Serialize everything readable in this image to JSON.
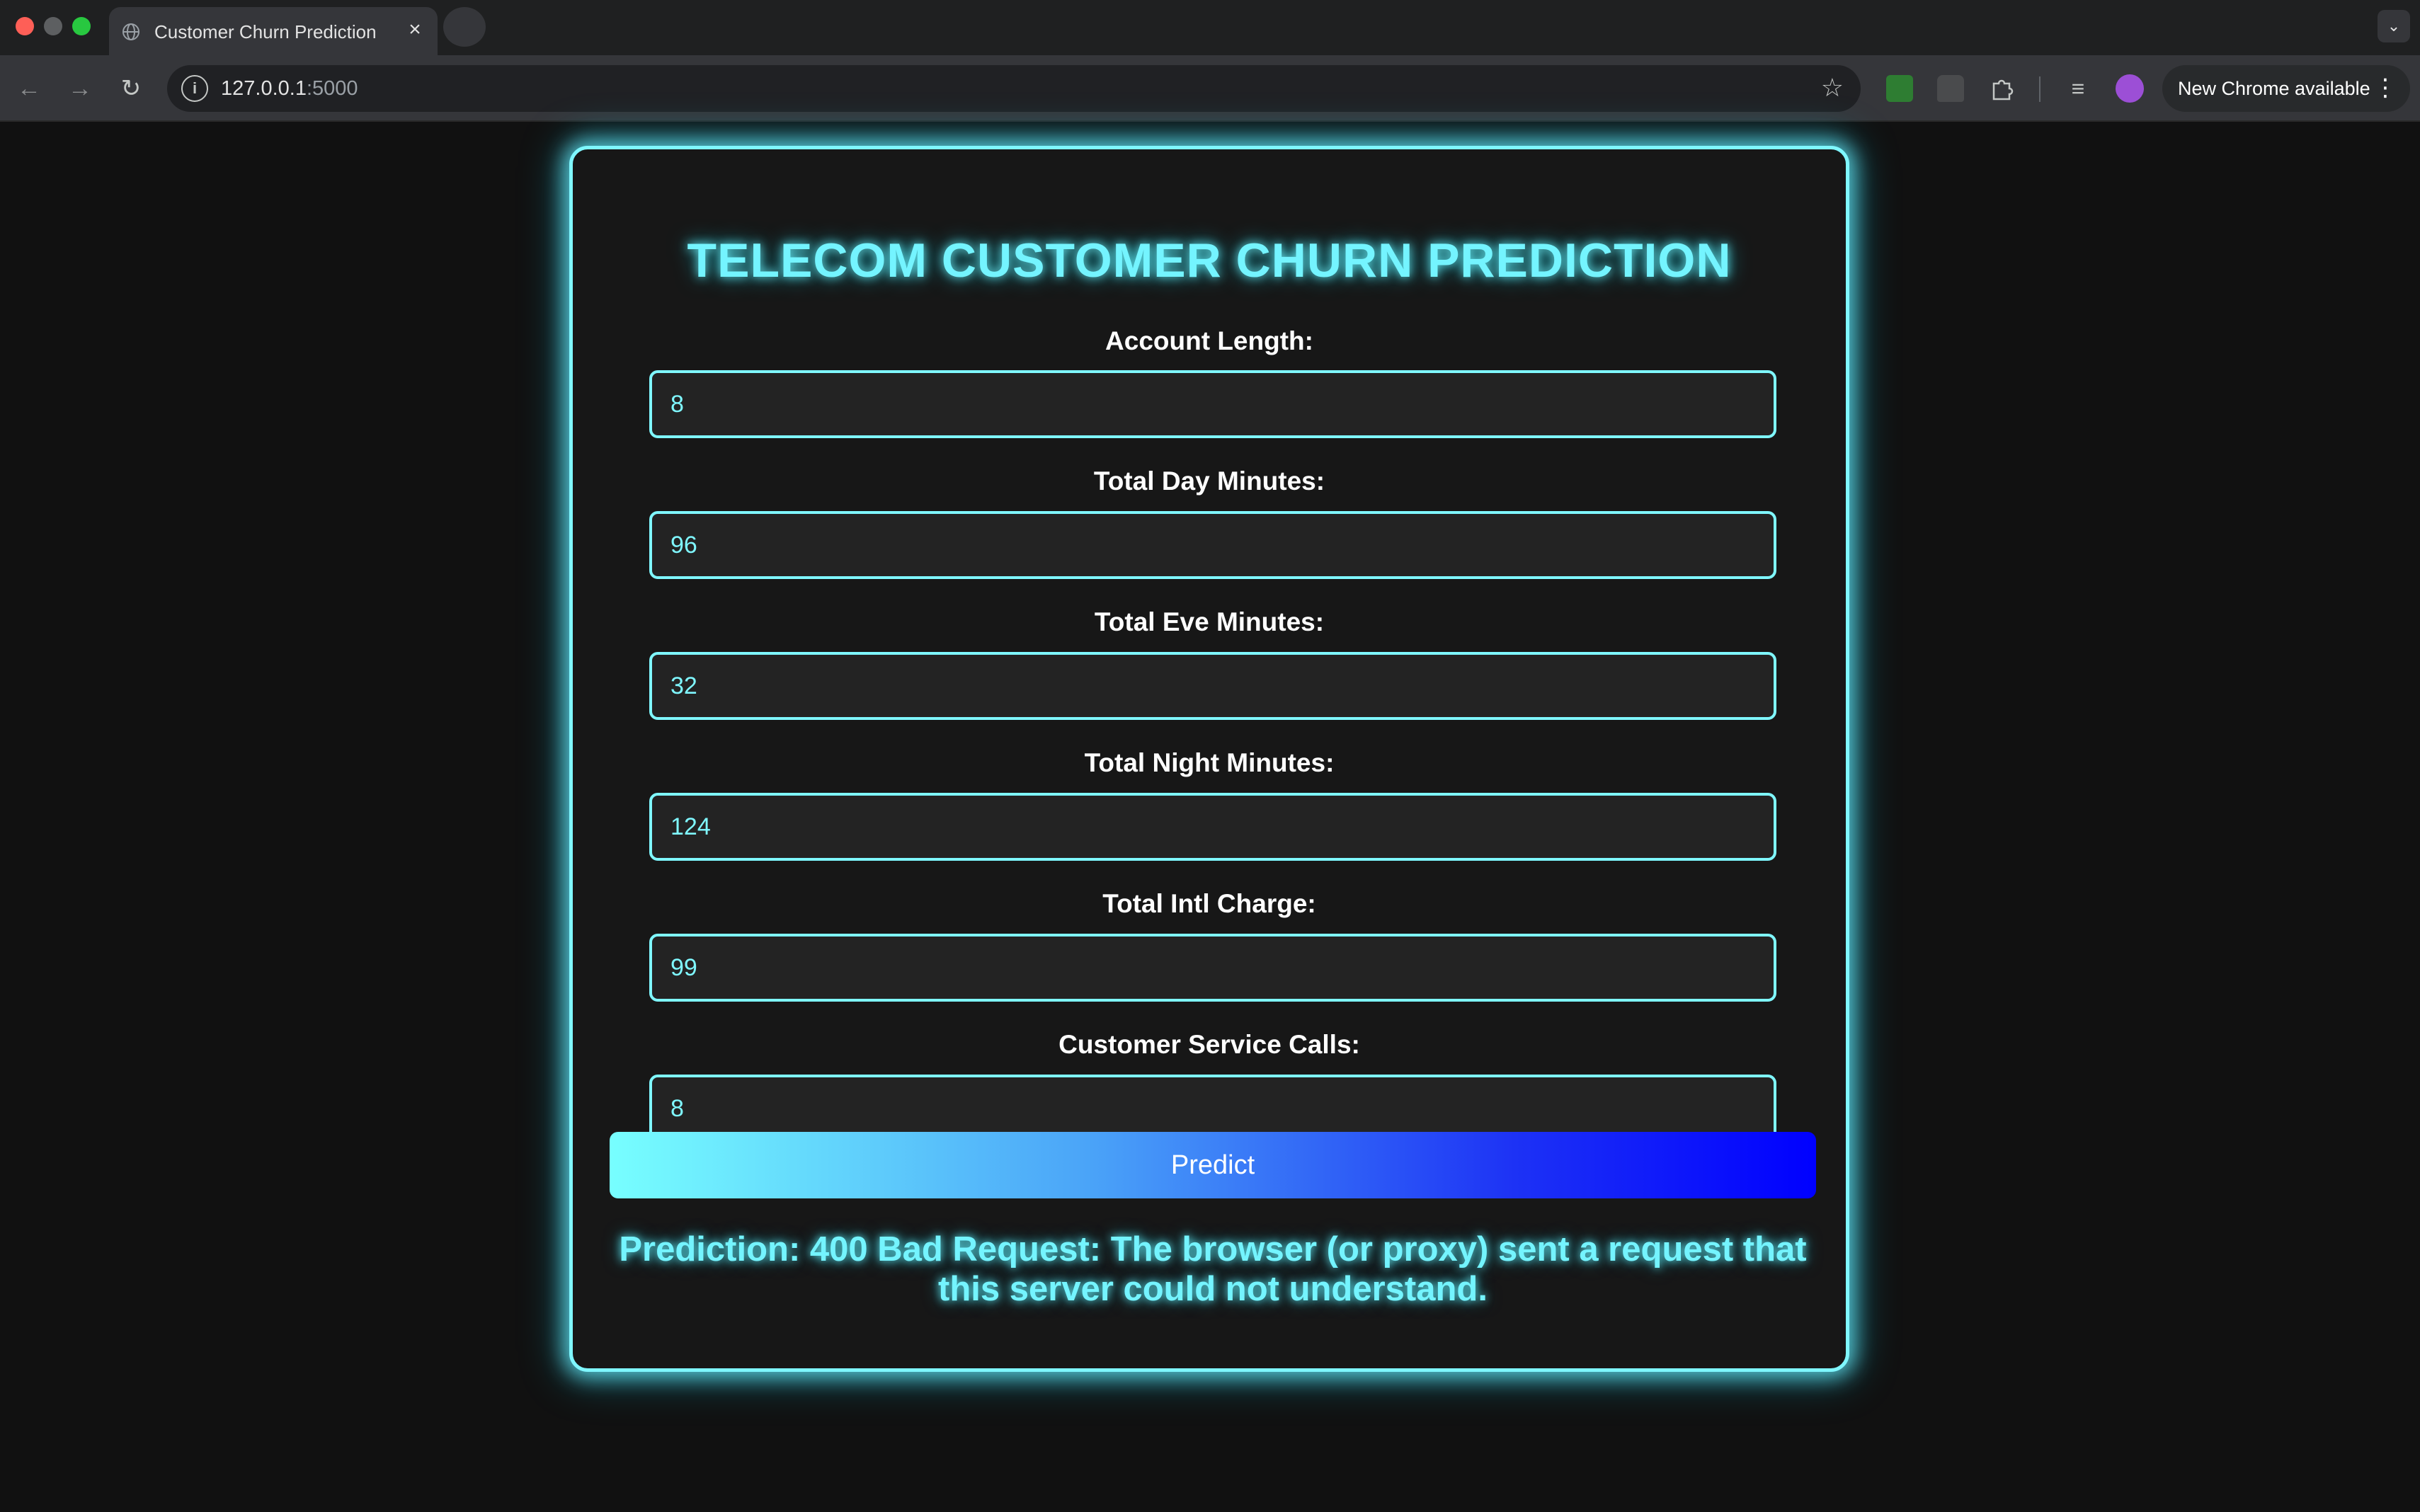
{
  "browser": {
    "tab_title": "Customer Churn Prediction",
    "tab_close_icon": "close-icon",
    "url_host": "127.0.0.1",
    "url_port": ":5000",
    "update_label": "New Chrome available",
    "icons": {
      "back": "arrow-left-icon",
      "forward": "arrow-right-icon",
      "reload": "reload-icon",
      "site_info": "info-icon",
      "bookmark": "star-icon",
      "menu": "kebab-menu-icon",
      "extensions": "puzzle-icon",
      "media": "media-queue-icon"
    }
  },
  "page": {
    "title": "TELECOM CUSTOMER CHURN PREDICTION",
    "fields": [
      {
        "label": "Account Length:",
        "value": "8"
      },
      {
        "label": "Total Day Minutes:",
        "value": "96"
      },
      {
        "label": "Total Eve Minutes:",
        "value": "32"
      },
      {
        "label": "Total Night Minutes:",
        "value": "124"
      },
      {
        "label": "Total Intl Charge:",
        "value": "99"
      },
      {
        "label": "Customer Service Calls:",
        "value": "8"
      }
    ],
    "predict_label": "Predict",
    "result_text": "Prediction: 400 Bad Request: The browser (or proxy) sent a request that this server could not understand."
  },
  "colors": {
    "accent": "#7ff7ff",
    "background": "#111111",
    "card": "#171717",
    "button_gradient_start": "#77ffff",
    "button_gradient_end": "#0000ff"
  }
}
